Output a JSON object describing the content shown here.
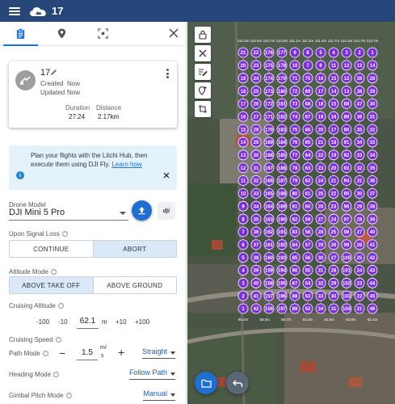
{
  "app": {
    "mission_number": "17"
  },
  "icons": {
    "menu": "menu-icon",
    "logo": "litchi-cloud-icon",
    "tab_mission": "clipboard-icon",
    "tab_location": "location-pin-icon",
    "tab_focus": "focus-frame-icon",
    "close": "close-icon"
  },
  "mission": {
    "name": "17",
    "created_label": "Created",
    "created_value": "Now",
    "updated_label": "Updated",
    "updated_value": "Now",
    "duration_label": "Duration",
    "duration_value": "27:24",
    "distance_label": "Distance",
    "distance_value": "2.17km"
  },
  "info": {
    "text": "Plan your flights with the Litchi Hub, then execute them using DJI Fly.",
    "link": "Learn how"
  },
  "drone": {
    "label": "Drone Model",
    "value": "DJI Mini 5 Pro",
    "dji_label": "dji"
  },
  "signal_loss": {
    "label": "Upon Signal Loss",
    "options": [
      "CONTINUE",
      "ABORT"
    ],
    "selected": "ABORT"
  },
  "altitude_mode": {
    "label": "Altitude Mode",
    "options": [
      "ABOVE TAKE OFF",
      "ABOVE GROUND"
    ],
    "selected": "ABOVE TAKE OFF"
  },
  "cruising_altitude": {
    "label": "Cruising Altitude",
    "dec100": "-100",
    "dec10": "-10",
    "value": "62.1",
    "unit": "m",
    "inc10": "+10",
    "inc100": "+100"
  },
  "cruising_speed": {
    "label": "Cruising Speed",
    "minus": "−",
    "value": "1.5",
    "unit_top": "m/",
    "unit_bottom": "s",
    "plus": "+"
  },
  "path_mode": {
    "label": "Path Mode",
    "value": "Straight"
  },
  "heading_mode": {
    "label": "Heading Mode",
    "value": "Follow Path"
  },
  "gimbal_mode": {
    "label": "Gimbal Pitch Mode",
    "value": "Manual"
  },
  "colors": {
    "topbar": "#27467a",
    "accent": "#1a73e8",
    "waypoint": "#7b2fd6",
    "fab": "#1e6fd1"
  },
  "waypoints": {
    "header_altitudes": [
      "110.4m",
      "110.5m",
      "110.7m",
      "110.8m",
      "111.1m",
      "111.2m",
      "111.4m",
      "111.7m",
      "112.4m",
      "113.7m",
      "113.7m"
    ],
    "numbers": [
      [
        "21",
        "22",
        "176",
        "177",
        "9",
        "8",
        "5",
        "4",
        "3",
        "2",
        "1"
      ],
      [
        "20",
        "23",
        "175",
        "178",
        "10",
        "7",
        "6",
        "11",
        "12",
        "13",
        "14"
      ],
      [
        "19",
        "24",
        "174",
        "179",
        "71",
        "70",
        "16",
        "15",
        "12",
        "39",
        "28"
      ],
      [
        "18",
        "25",
        "173",
        "180",
        "72",
        "69",
        "17",
        "14",
        "13",
        "38",
        "29"
      ],
      [
        "17",
        "26",
        "172",
        "181",
        "73",
        "68",
        "18",
        "15",
        "88",
        "37",
        "30"
      ],
      [
        "16",
        "27",
        "171",
        "182",
        "74",
        "67",
        "19",
        "16",
        "89",
        "36",
        "31"
      ],
      [
        "15",
        "28",
        "170",
        "183",
        "75",
        "66",
        "20",
        "17",
        "90",
        "35",
        "32"
      ],
      [
        "14",
        "29",
        "169",
        "184",
        "76",
        "65",
        "21",
        "18",
        "91",
        "34",
        "33"
      ],
      [
        "13",
        "30",
        "168",
        "185",
        "77",
        "64",
        "22",
        "19",
        "92",
        "33",
        "34"
      ],
      [
        "12",
        "31",
        "167",
        "186",
        "78",
        "63",
        "23",
        "20",
        "93",
        "32",
        "35"
      ],
      [
        "11",
        "32",
        "166",
        "187",
        "79",
        "62",
        "24",
        "21",
        "94",
        "31",
        "36"
      ],
      [
        "10",
        "33",
        "165",
        "188",
        "80",
        "61",
        "25",
        "22",
        "95",
        "30",
        "37"
      ],
      [
        "9",
        "34",
        "164",
        "189",
        "81",
        "60",
        "26",
        "23",
        "96",
        "29",
        "38"
      ],
      [
        "8",
        "35",
        "163",
        "190",
        "82",
        "59",
        "27",
        "24",
        "97",
        "28",
        "39"
      ],
      [
        "7",
        "36",
        "162",
        "191",
        "83",
        "58",
        "28",
        "25",
        "98",
        "27",
        "40"
      ],
      [
        "6",
        "37",
        "161",
        "192",
        "84",
        "57",
        "29",
        "26",
        "99",
        "26",
        "41"
      ],
      [
        "5",
        "38",
        "160",
        "193",
        "85",
        "56",
        "30",
        "27",
        "100",
        "25",
        "42"
      ],
      [
        "4",
        "39",
        "159",
        "194",
        "86",
        "55",
        "31",
        "28",
        "101",
        "24",
        "43"
      ],
      [
        "3",
        "40",
        "158",
        "195",
        "87",
        "54",
        "32",
        "29",
        "102",
        "23",
        "44"
      ],
      [
        "2",
        "41",
        "157",
        "196",
        "88",
        "53",
        "33",
        "30",
        "103",
        "22",
        "45"
      ],
      [
        "1",
        "42",
        "156",
        "197",
        "89",
        "52",
        "34",
        "31",
        "104",
        "21",
        "46"
      ]
    ],
    "footer_altitudes": [
      "68.4m",
      "68.3m",
      "66.7m",
      "64.3m",
      "63.5m",
      "63.9m",
      "62.1m"
    ]
  }
}
